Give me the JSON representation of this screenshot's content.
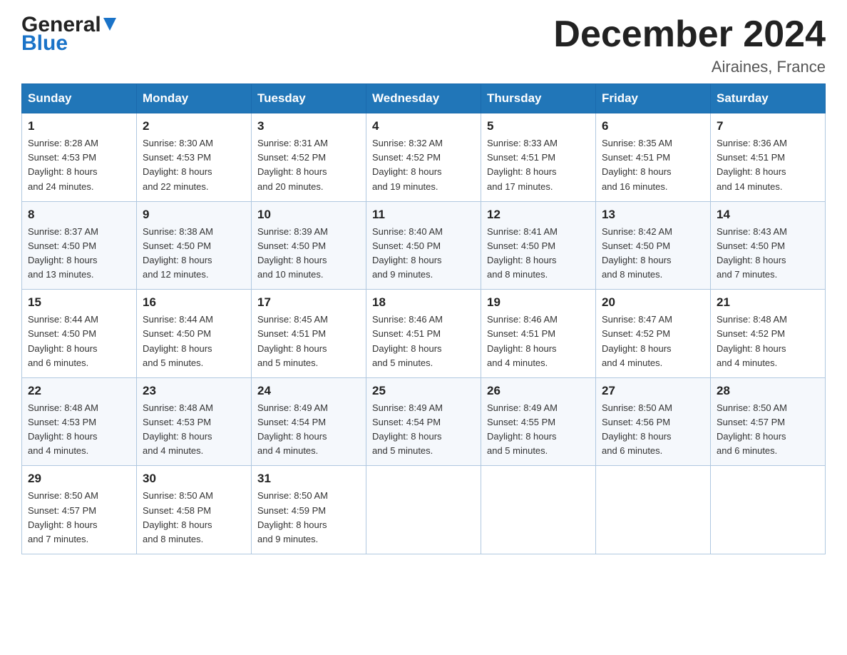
{
  "header": {
    "logo_general": "General",
    "logo_blue": "Blue",
    "title": "December 2024",
    "location": "Airaines, France"
  },
  "days_of_week": [
    "Sunday",
    "Monday",
    "Tuesday",
    "Wednesday",
    "Thursday",
    "Friday",
    "Saturday"
  ],
  "weeks": [
    [
      {
        "day": "1",
        "sunrise": "8:28 AM",
        "sunset": "4:53 PM",
        "daylight": "8 hours and 24 minutes."
      },
      {
        "day": "2",
        "sunrise": "8:30 AM",
        "sunset": "4:53 PM",
        "daylight": "8 hours and 22 minutes."
      },
      {
        "day": "3",
        "sunrise": "8:31 AM",
        "sunset": "4:52 PM",
        "daylight": "8 hours and 20 minutes."
      },
      {
        "day": "4",
        "sunrise": "8:32 AM",
        "sunset": "4:52 PM",
        "daylight": "8 hours and 19 minutes."
      },
      {
        "day": "5",
        "sunrise": "8:33 AM",
        "sunset": "4:51 PM",
        "daylight": "8 hours and 17 minutes."
      },
      {
        "day": "6",
        "sunrise": "8:35 AM",
        "sunset": "4:51 PM",
        "daylight": "8 hours and 16 minutes."
      },
      {
        "day": "7",
        "sunrise": "8:36 AM",
        "sunset": "4:51 PM",
        "daylight": "8 hours and 14 minutes."
      }
    ],
    [
      {
        "day": "8",
        "sunrise": "8:37 AM",
        "sunset": "4:50 PM",
        "daylight": "8 hours and 13 minutes."
      },
      {
        "day": "9",
        "sunrise": "8:38 AM",
        "sunset": "4:50 PM",
        "daylight": "8 hours and 12 minutes."
      },
      {
        "day": "10",
        "sunrise": "8:39 AM",
        "sunset": "4:50 PM",
        "daylight": "8 hours and 10 minutes."
      },
      {
        "day": "11",
        "sunrise": "8:40 AM",
        "sunset": "4:50 PM",
        "daylight": "8 hours and 9 minutes."
      },
      {
        "day": "12",
        "sunrise": "8:41 AM",
        "sunset": "4:50 PM",
        "daylight": "8 hours and 8 minutes."
      },
      {
        "day": "13",
        "sunrise": "8:42 AM",
        "sunset": "4:50 PM",
        "daylight": "8 hours and 8 minutes."
      },
      {
        "day": "14",
        "sunrise": "8:43 AM",
        "sunset": "4:50 PM",
        "daylight": "8 hours and 7 minutes."
      }
    ],
    [
      {
        "day": "15",
        "sunrise": "8:44 AM",
        "sunset": "4:50 PM",
        "daylight": "8 hours and 6 minutes."
      },
      {
        "day": "16",
        "sunrise": "8:44 AM",
        "sunset": "4:50 PM",
        "daylight": "8 hours and 5 minutes."
      },
      {
        "day": "17",
        "sunrise": "8:45 AM",
        "sunset": "4:51 PM",
        "daylight": "8 hours and 5 minutes."
      },
      {
        "day": "18",
        "sunrise": "8:46 AM",
        "sunset": "4:51 PM",
        "daylight": "8 hours and 5 minutes."
      },
      {
        "day": "19",
        "sunrise": "8:46 AM",
        "sunset": "4:51 PM",
        "daylight": "8 hours and 4 minutes."
      },
      {
        "day": "20",
        "sunrise": "8:47 AM",
        "sunset": "4:52 PM",
        "daylight": "8 hours and 4 minutes."
      },
      {
        "day": "21",
        "sunrise": "8:48 AM",
        "sunset": "4:52 PM",
        "daylight": "8 hours and 4 minutes."
      }
    ],
    [
      {
        "day": "22",
        "sunrise": "8:48 AM",
        "sunset": "4:53 PM",
        "daylight": "8 hours and 4 minutes."
      },
      {
        "day": "23",
        "sunrise": "8:48 AM",
        "sunset": "4:53 PM",
        "daylight": "8 hours and 4 minutes."
      },
      {
        "day": "24",
        "sunrise": "8:49 AM",
        "sunset": "4:54 PM",
        "daylight": "8 hours and 4 minutes."
      },
      {
        "day": "25",
        "sunrise": "8:49 AM",
        "sunset": "4:54 PM",
        "daylight": "8 hours and 5 minutes."
      },
      {
        "day": "26",
        "sunrise": "8:49 AM",
        "sunset": "4:55 PM",
        "daylight": "8 hours and 5 minutes."
      },
      {
        "day": "27",
        "sunrise": "8:50 AM",
        "sunset": "4:56 PM",
        "daylight": "8 hours and 6 minutes."
      },
      {
        "day": "28",
        "sunrise": "8:50 AM",
        "sunset": "4:57 PM",
        "daylight": "8 hours and 6 minutes."
      }
    ],
    [
      {
        "day": "29",
        "sunrise": "8:50 AM",
        "sunset": "4:57 PM",
        "daylight": "8 hours and 7 minutes."
      },
      {
        "day": "30",
        "sunrise": "8:50 AM",
        "sunset": "4:58 PM",
        "daylight": "8 hours and 8 minutes."
      },
      {
        "day": "31",
        "sunrise": "8:50 AM",
        "sunset": "4:59 PM",
        "daylight": "8 hours and 9 minutes."
      },
      null,
      null,
      null,
      null
    ]
  ],
  "labels": {
    "sunrise": "Sunrise:",
    "sunset": "Sunset:",
    "daylight": "Daylight:"
  }
}
